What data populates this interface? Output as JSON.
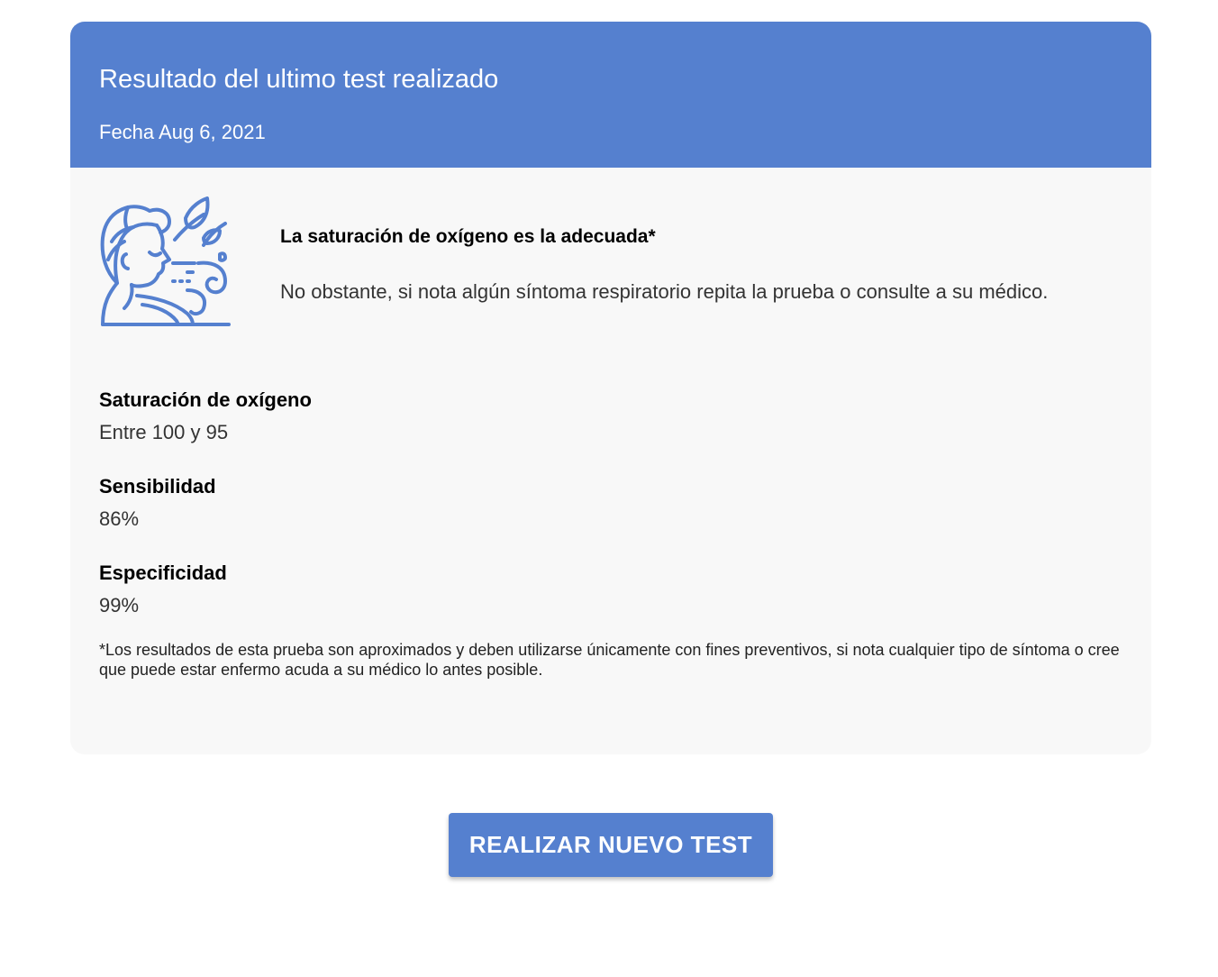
{
  "header": {
    "title": "Resultado del ultimo test realizado",
    "date": "Fecha Aug 6, 2021"
  },
  "summary": {
    "icon": "person-breathing-icon",
    "title": "La saturación de oxígeno es la adecuada*",
    "text": "No obstante, si nota algún síntoma respiratorio repita la prueba o consulte a su médico."
  },
  "metrics": [
    {
      "label": "Saturación de oxígeno",
      "value": "Entre 100 y 95"
    },
    {
      "label": "Sensibilidad",
      "value": "86%"
    },
    {
      "label": "Especificidad",
      "value": "99%"
    }
  ],
  "disclaimer": "*Los resultados de esta prueba son aproximados y deben utilizarse únicamente con fines preventivos, si nota cualquier tipo de síntoma o cree que puede estar enfermo acuda a su médico lo antes posible.",
  "action": {
    "label": "REALIZAR NUEVO TEST"
  },
  "colors": {
    "primary": "#5580cf",
    "card_background": "#f8f8f8",
    "page_background": "#ffffff"
  }
}
